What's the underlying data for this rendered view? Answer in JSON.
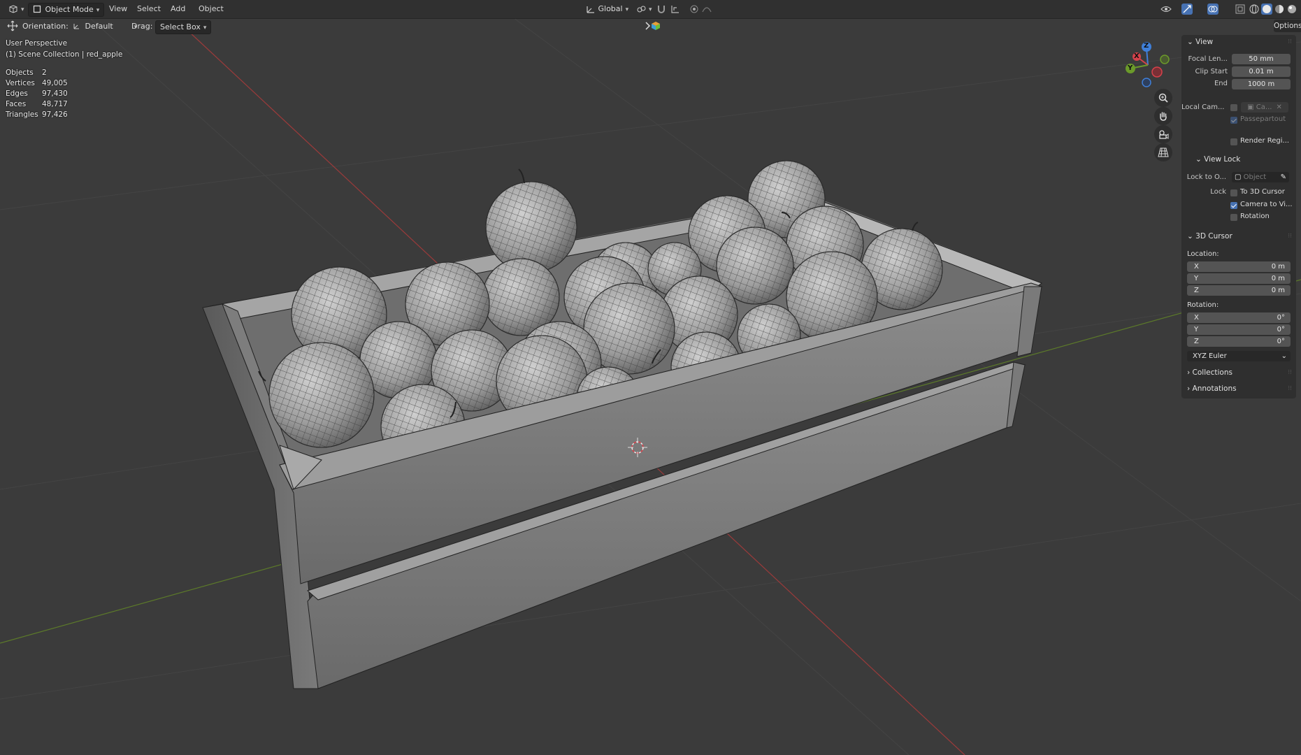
{
  "header": {
    "editor_type_icon": "3d-viewport-icon",
    "mode": "Object Mode",
    "menus": [
      "View",
      "Select",
      "Add",
      "Object"
    ],
    "transform_orientation": "Global"
  },
  "toolbar": {
    "orientation_label": "Orientation:",
    "orientation_value": "Default",
    "drag_label": "Drag:",
    "drag_value": "Select Box",
    "options_label": "Options"
  },
  "overlay": {
    "perspective": "User Perspective",
    "collection": "(1) Scene Collection | red_apple",
    "stats": [
      {
        "label": "Objects",
        "value": "2"
      },
      {
        "label": "Vertices",
        "value": "49,005"
      },
      {
        "label": "Edges",
        "value": "97,430"
      },
      {
        "label": "Faces",
        "value": "48,717"
      },
      {
        "label": "Triangles",
        "value": "97,426"
      }
    ]
  },
  "gizmo": {
    "x": "X",
    "y": "Y",
    "z": "Z"
  },
  "npanel": {
    "view": {
      "title": "View",
      "focal_label": "Focal Len...",
      "focal_value": "50 mm",
      "clip_start_label": "Clip Start",
      "clip_start_value": "0.01 m",
      "clip_end_label": "End",
      "clip_end_value": "1000 m",
      "local_cam_label": "Local Cam...",
      "local_cam_value": "Ca...",
      "passepartout_label": "Passepartout",
      "render_region_label": "Render Regi..."
    },
    "view_lock": {
      "title": "View Lock",
      "lock_to_label": "Lock to O...",
      "lock_to_placeholder": "Object",
      "lock_label": "Lock",
      "to_cursor_label": "To 3D Cursor",
      "to_cursor_checked": false,
      "camera_to_view_label": "Camera to Vi...",
      "camera_to_view_checked": true,
      "rotation_label": "Rotation",
      "rotation_checked": false
    },
    "cursor": {
      "title": "3D Cursor",
      "location_label": "Location:",
      "location": [
        {
          "axis": "X",
          "value": "0 m"
        },
        {
          "axis": "Y",
          "value": "0 m"
        },
        {
          "axis": "Z",
          "value": "0 m"
        }
      ],
      "rotation_label": "Rotation:",
      "rotation": [
        {
          "axis": "X",
          "value": "0°"
        },
        {
          "axis": "Y",
          "value": "0°"
        },
        {
          "axis": "Z",
          "value": "0°"
        }
      ],
      "rotation_mode": "XYZ Euler"
    },
    "collections_title": "Collections",
    "annotations_title": "Annotations"
  },
  "colors": {
    "background": "#3b3b3b",
    "panel": "#2f2f2f",
    "field": "#545454",
    "accent": "#4772b3",
    "x_axis": "#d6424b",
    "y_axis": "#6b9a2a",
    "z_axis": "#3f7fd9"
  }
}
